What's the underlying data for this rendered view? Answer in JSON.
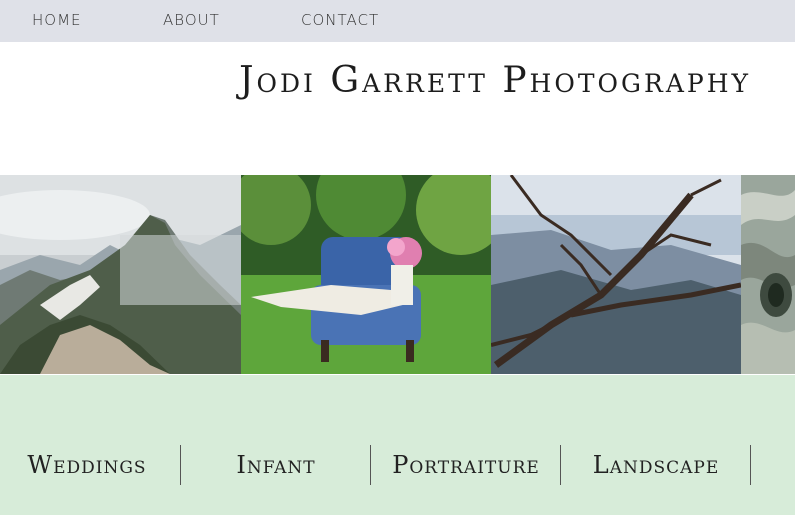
{
  "nav": {
    "home": "HOME",
    "about": "ABOUT",
    "contact": "CONTACT"
  },
  "site": {
    "title": "Jodi Garrett Photography"
  },
  "gallery": {
    "photos": [
      "mountain-photo",
      "blue-chair-photo",
      "branches-photo",
      "tree-bark-photo"
    ]
  },
  "categories": {
    "weddings": "Weddings",
    "infant": "Infant",
    "portraiture": "Portraiture",
    "landscape": "Landscape"
  },
  "colors": {
    "nav_bg": "#dfe1e8",
    "category_bg": "#d7ecd9"
  }
}
